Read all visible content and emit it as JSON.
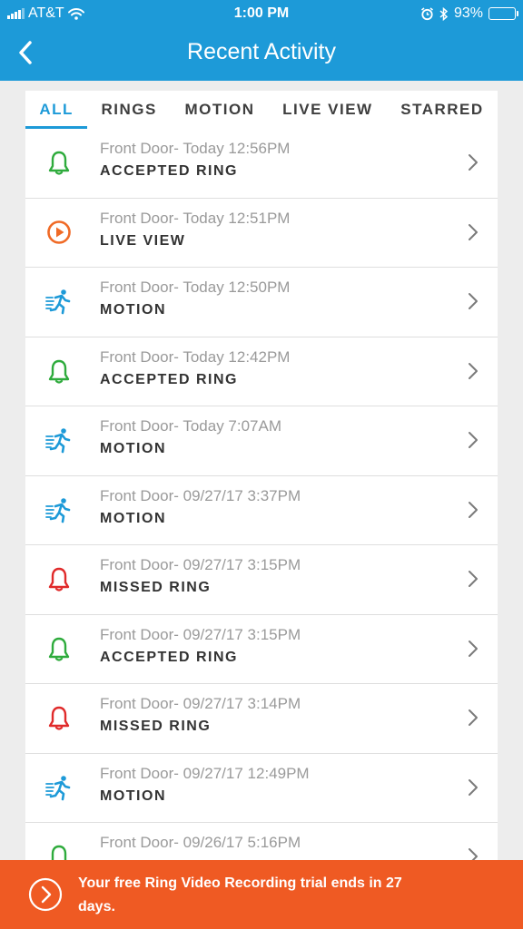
{
  "status_bar": {
    "carrier": "AT&T",
    "time": "1:00 PM",
    "battery": "93%",
    "battery_level": 0.93
  },
  "nav": {
    "title": "Recent Activity",
    "back_icon": "chevron-left-icon"
  },
  "tabs": [
    {
      "label": "ALL",
      "active": true
    },
    {
      "label": "RINGS",
      "active": false
    },
    {
      "label": "MOTION",
      "active": false
    },
    {
      "label": "LIVE VIEW",
      "active": false
    },
    {
      "label": "STARRED",
      "active": false
    }
  ],
  "events": [
    {
      "kind": "ring-accepted",
      "icon": "bell-icon",
      "color": "#2eab3c",
      "line1": "Front Door- Today 12:56PM",
      "line2": "ACCEPTED RING"
    },
    {
      "kind": "live-view",
      "icon": "play-icon",
      "color": "#f06a26",
      "line1": "Front Door- Today 12:51PM",
      "line2": "LIVE VIEW"
    },
    {
      "kind": "motion",
      "icon": "motion-runner-icon",
      "color": "#1d9ad8",
      "line1": "Front Door- Today 12:50PM",
      "line2": "MOTION"
    },
    {
      "kind": "ring-accepted",
      "icon": "bell-icon",
      "color": "#2eab3c",
      "line1": "Front Door- Today 12:42PM",
      "line2": "ACCEPTED RING"
    },
    {
      "kind": "motion",
      "icon": "motion-runner-icon",
      "color": "#1d9ad8",
      "line1": "Front Door- Today 7:07AM",
      "line2": "MOTION"
    },
    {
      "kind": "motion",
      "icon": "motion-runner-icon",
      "color": "#1d9ad8",
      "line1": "Front Door- 09/27/17 3:37PM",
      "line2": "MOTION"
    },
    {
      "kind": "ring-missed",
      "icon": "bell-icon",
      "color": "#e02a2a",
      "line1": "Front Door- 09/27/17 3:15PM",
      "line2": "MISSED RING"
    },
    {
      "kind": "ring-accepted",
      "icon": "bell-icon",
      "color": "#2eab3c",
      "line1": "Front Door- 09/27/17 3:15PM",
      "line2": "ACCEPTED RING"
    },
    {
      "kind": "ring-missed",
      "icon": "bell-icon",
      "color": "#e02a2a",
      "line1": "Front Door- 09/27/17 3:14PM",
      "line2": "MISSED RING"
    },
    {
      "kind": "motion",
      "icon": "motion-runner-icon",
      "color": "#1d9ad8",
      "line1": "Front Door- 09/27/17 12:49PM",
      "line2": "MOTION"
    },
    {
      "kind": "ring-accepted",
      "icon": "bell-icon",
      "color": "#2eab3c",
      "line1": "Front Door- 09/26/17 5:16PM",
      "line2": ""
    }
  ],
  "banner": {
    "text": "Your free Ring Video Recording trial ends in 27 days.",
    "icon": "circle-chevron-right-icon",
    "color": "#ef5a23"
  },
  "colors": {
    "brand_blue": "#1d9ad8",
    "background": "#ededed"
  }
}
